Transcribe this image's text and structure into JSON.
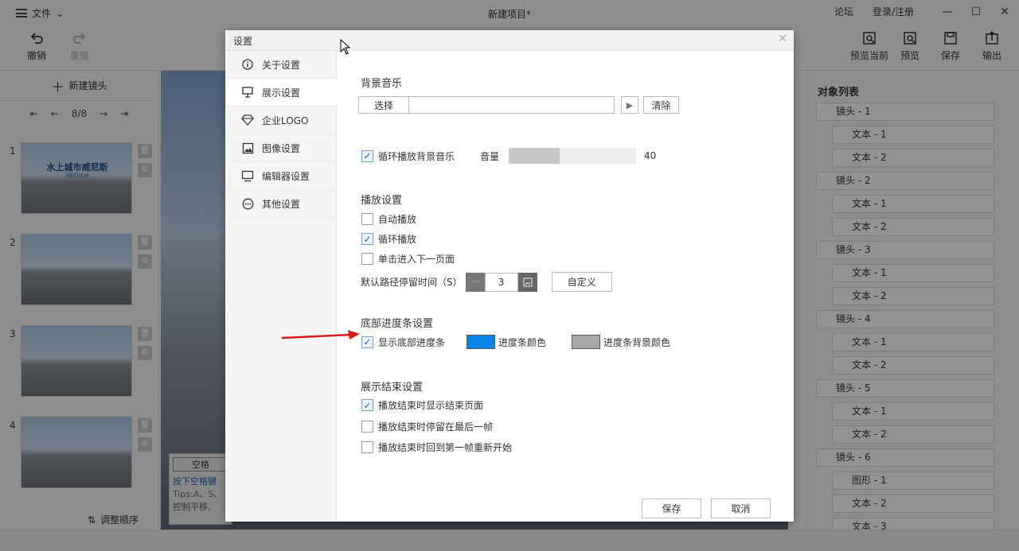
{
  "app": {
    "menu_label": "文件",
    "title": "新建项目*",
    "title_links": [
      "论坛",
      "登录/注册"
    ],
    "toolbar": {
      "undo": "撤销",
      "redo": "重做",
      "preview_current": "预览当前",
      "preview": "预览",
      "save": "保存",
      "export": "输出"
    },
    "left_panel": {
      "new_shot": "新建镜头",
      "pager": "8/8",
      "thumbs": [
        {
          "num": "1",
          "title": "水上城市威尼斯",
          "subtitle": "Venice"
        },
        {
          "num": "2"
        },
        {
          "num": "3"
        },
        {
          "num": "4"
        }
      ],
      "reorder": "调整顺序"
    },
    "canvas": {
      "space_key": "空格",
      "hint_blue": "按下空格键",
      "hint_gray1": "Tips:A、S、",
      "hint_gray2": "控制平移,"
    },
    "object_list": {
      "title": "对象列表",
      "items": [
        {
          "label": "镜头 - 1",
          "level": 0
        },
        {
          "label": "文本 - 1",
          "level": 1
        },
        {
          "label": "文本 - 2",
          "level": 1
        },
        {
          "label": "镜头 - 2",
          "level": 0
        },
        {
          "label": "文本 - 1",
          "level": 1
        },
        {
          "label": "文本 - 2",
          "level": 1
        },
        {
          "label": "镜头 - 3",
          "level": 0
        },
        {
          "label": "文本 - 1",
          "level": 1
        },
        {
          "label": "文本 - 2",
          "level": 1
        },
        {
          "label": "镜头 - 4",
          "level": 0
        },
        {
          "label": "文本 - 1",
          "level": 1
        },
        {
          "label": "文本 - 2",
          "level": 1
        },
        {
          "label": "镜头 - 5",
          "level": 0
        },
        {
          "label": "文本 - 1",
          "level": 1
        },
        {
          "label": "文本 - 2",
          "level": 1
        },
        {
          "label": "镜头 - 6",
          "level": 0
        },
        {
          "label": "图形 - 1",
          "level": 1
        },
        {
          "label": "文本 - 2",
          "level": 1
        },
        {
          "label": "文本 - 3",
          "level": 1
        }
      ]
    }
  },
  "dialog": {
    "title": "设置",
    "nav": [
      {
        "label": "关于设置",
        "icon": "info-icon"
      },
      {
        "label": "展示设置",
        "icon": "presentation-icon",
        "active": true
      },
      {
        "label": "企业LOGO",
        "icon": "diamond-icon"
      },
      {
        "label": "图像设置",
        "icon": "image-icon"
      },
      {
        "label": "编辑器设置",
        "icon": "monitor-icon"
      },
      {
        "label": "其他设置",
        "icon": "more-icon"
      }
    ],
    "bgm": {
      "title": "背景音乐",
      "select_label": "选择",
      "clear_label": "清除",
      "loop_label": "循环播放背景音乐",
      "loop_checked": true,
      "volume_label": "音量",
      "volume_value": "40",
      "volume": 40
    },
    "playback": {
      "title": "播放设置",
      "autoplay_label": "自动播放",
      "autoplay_checked": false,
      "loop_label": "循环播放",
      "loop_checked": true,
      "click_next_label": "单击进入下一页面",
      "click_next_checked": false,
      "dwell_label": "默认路径停留时间（S）",
      "dwell_value": "3",
      "custom_label": "自定义"
    },
    "progress": {
      "title": "底部进度条设置",
      "show_label": "显示底部进度条",
      "show_checked": true,
      "bar_color_label": "进度条颜色",
      "bar_color": "#0a84e6",
      "bg_color_label": "进度条背景颜色",
      "bg_color": "#a8a8a8"
    },
    "end": {
      "title": "展示结束设置",
      "show_end_label": "播放结束时显示结束页面",
      "show_end_checked": true,
      "stay_last_label": "播放结束时停留在最后一帧",
      "stay_last_checked": false,
      "restart_label": "播放结束时回到第一帧重新开始",
      "restart_checked": false
    },
    "save_label": "保存",
    "cancel_label": "取消"
  },
  "colors": {
    "annotation_arrow": "#d61d1d"
  }
}
